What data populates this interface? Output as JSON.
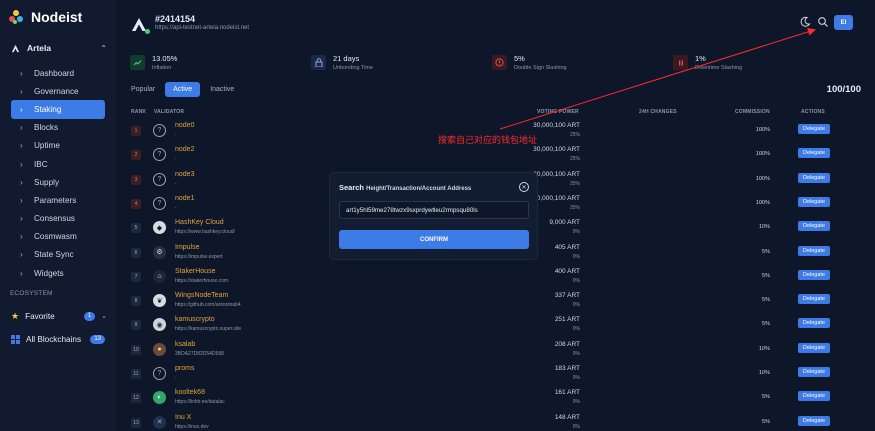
{
  "app": {
    "brand": "Nodeist",
    "chain": "Artela",
    "ecosystem_label": "ECOSYSTEM",
    "favorite_label": "Favorite",
    "favorite_count": "1",
    "all_blockchains_label": "All Blockchains",
    "all_blockchains_count": "13"
  },
  "sidebar": {
    "items": [
      {
        "label": "Dashboard",
        "active": false
      },
      {
        "label": "Governance",
        "active": false
      },
      {
        "label": "Staking",
        "active": true
      },
      {
        "label": "Blocks",
        "active": false
      },
      {
        "label": "Uptime",
        "active": false
      },
      {
        "label": "IBC",
        "active": false
      },
      {
        "label": "Supply",
        "active": false
      },
      {
        "label": "Parameters",
        "active": false
      },
      {
        "label": "Consensus",
        "active": false
      },
      {
        "label": "Cosmwasm",
        "active": false
      },
      {
        "label": "State Sync",
        "active": false
      },
      {
        "label": "Widgets",
        "active": false
      }
    ]
  },
  "header": {
    "block": "#2414154",
    "url": "https://api-testnet-artela.nodeist.net",
    "avatar_label": "EI"
  },
  "stats": [
    {
      "value": "13.05%",
      "label": "Inflation",
      "icon": "chart-up-icon",
      "color": "#3fd07a",
      "bg": "#143a2f"
    },
    {
      "value": "21 days",
      "label": "Unbonding Time",
      "icon": "lock-icon",
      "color": "#8aa6d8",
      "bg": "#1b2845"
    },
    {
      "value": "5%",
      "label": "Double Sign Slashing",
      "icon": "alert-icon",
      "color": "#e05252",
      "bg": "#3a1a22"
    },
    {
      "value": "1%",
      "label": "Downtime Slashing",
      "icon": "pause-icon",
      "color": "#e05252",
      "bg": "#3a1a22"
    }
  ],
  "tabs": [
    {
      "label": "Popular",
      "active": false
    },
    {
      "label": "Active",
      "active": true
    },
    {
      "label": "Inactive",
      "active": false
    }
  ],
  "count": "100/100",
  "table": {
    "columns": [
      "RANK",
      "VALIDATOR",
      "VOTING POWER",
      "24H CHANGES",
      "COMMISSION",
      "ACTIONS"
    ],
    "action_label": "Delegate",
    "rows": [
      {
        "rank": "1",
        "name": "node0",
        "site": "-",
        "power": "30,000,100 ART",
        "pct": "25%",
        "commission": "100%",
        "icon": "question-icon"
      },
      {
        "rank": "2",
        "name": "node2",
        "site": "-",
        "power": "30,000,100 ART",
        "pct": "25%",
        "commission": "100%",
        "icon": "question-icon"
      },
      {
        "rank": "3",
        "name": "node3",
        "site": "-",
        "power": "30,000,100 ART",
        "pct": "25%",
        "commission": "100%",
        "icon": "question-icon"
      },
      {
        "rank": "4",
        "name": "node1",
        "site": "-",
        "power": "30,000,100 ART",
        "pct": "25%",
        "commission": "100%",
        "icon": "question-icon"
      },
      {
        "rank": "5",
        "name": "HashKey Cloud",
        "site": "https://www.hashkey.cloud/",
        "power": "9,000 ART",
        "pct": "0%",
        "commission": "10%",
        "icon": "hashkey-icon"
      },
      {
        "rank": "6",
        "name": "Impulse",
        "site": "https://impulse.expert",
        "power": "405 ART",
        "pct": "0%",
        "commission": "5%",
        "icon": "impulse-icon"
      },
      {
        "rank": "7",
        "name": "StakerHouse",
        "site": "https://stakerhouse.com",
        "power": "400 ART",
        "pct": "0%",
        "commission": "5%",
        "icon": "stakerhouse-icon"
      },
      {
        "rank": "8",
        "name": "WingsNodeTeam",
        "site": "https://github.com/antoninab4",
        "power": "337 ART",
        "pct": "0%",
        "commission": "5%",
        "icon": "wings-icon"
      },
      {
        "rank": "9",
        "name": "kamuscrypto",
        "site": "https://kamuscrypto.super.site",
        "power": "251 ART",
        "pct": "0%",
        "commission": "5%",
        "icon": "kamus-icon"
      },
      {
        "rank": "10",
        "name": "ksalab",
        "site": "3BDA27D82D54D598",
        "power": "208 ART",
        "pct": "0%",
        "commission": "10%",
        "icon": "ksalab-icon"
      },
      {
        "rank": "11",
        "name": "proms",
        "site": "-",
        "power": "183 ART",
        "pct": "0%",
        "commission": "10%",
        "icon": "question-icon"
      },
      {
        "rank": "12",
        "name": "kooltek68",
        "site": "https://linktr.ee/datalac",
        "power": "161 ART",
        "pct": "0%",
        "commission": "5%",
        "icon": "kooltek-icon"
      },
      {
        "rank": "13",
        "name": "Inu X",
        "site": "https://inux.dev",
        "power": "148 ART",
        "pct": "0%",
        "commission": "5%",
        "icon": "inux-icon"
      }
    ]
  },
  "modal": {
    "title": "Search",
    "subtitle": "Height/Transaction/Account Address",
    "input_value": "art1y5hl59me278twzx9sxprdywtleu2rmpsqu80ls",
    "confirm_label": "CONFIRM"
  },
  "annotation": {
    "text": "搜索自己对应的钱包地址",
    "color": "#ff2b2b"
  }
}
